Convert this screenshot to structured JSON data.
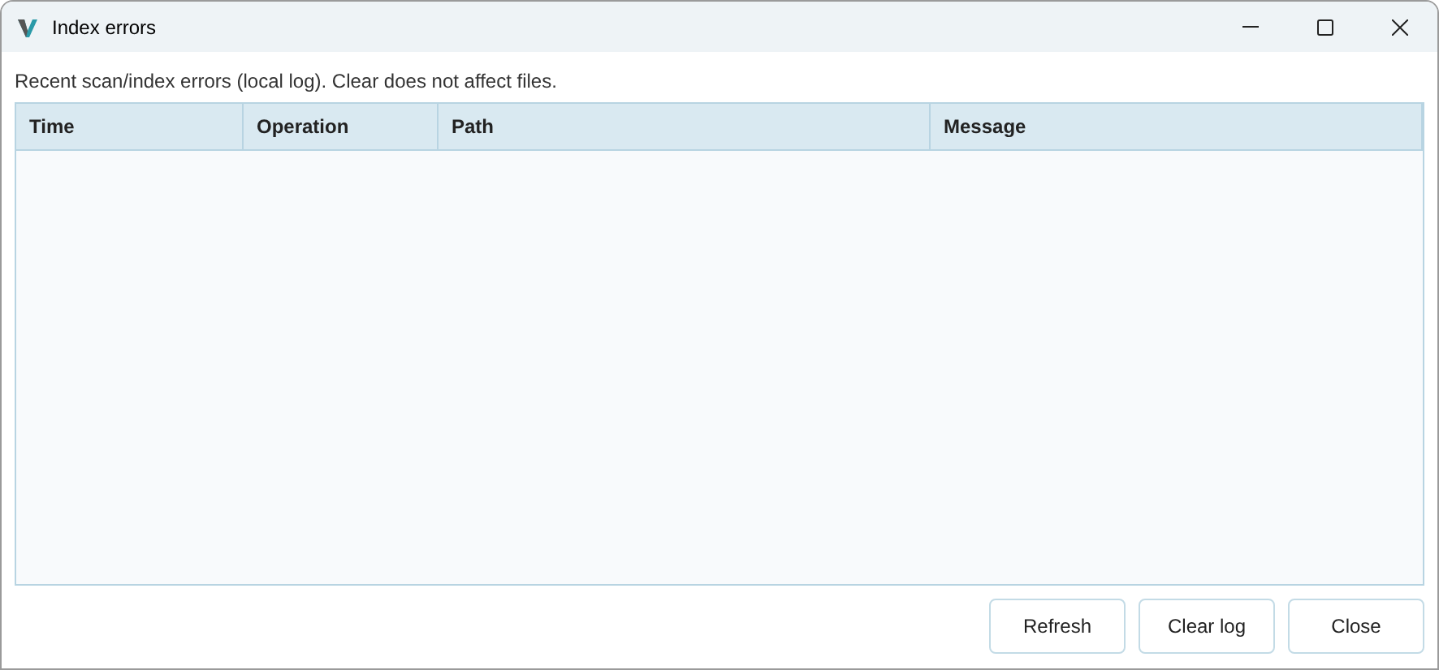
{
  "window": {
    "title": "Index errors"
  },
  "description": "Recent scan/index errors (local log). Clear does not affect files.",
  "table": {
    "columns": [
      "Time",
      "Operation",
      "Path",
      "Message"
    ]
  },
  "buttons": [
    "Refresh",
    "Clear log",
    "Close"
  ]
}
